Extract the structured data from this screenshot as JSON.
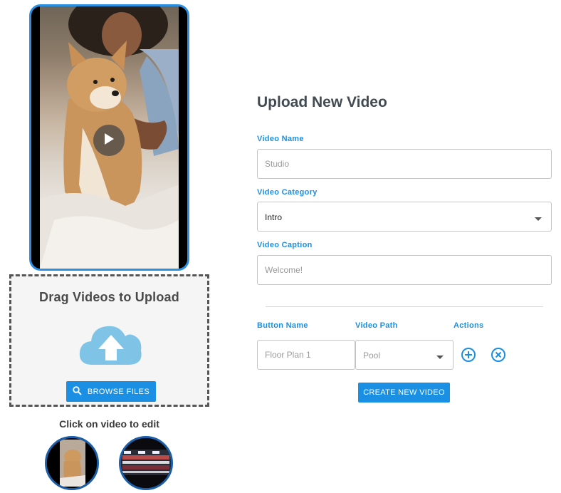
{
  "preview": {
    "play_icon": "play-icon"
  },
  "dropzone": {
    "title": "Drag Videos to Upload",
    "upload_icon": "cloud-upload-icon",
    "browse_label": "BROWSE FILES",
    "browse_icon": "search-icon"
  },
  "thumbnails": {
    "caption": "Click on video to edit",
    "items": [
      "video-thumbnail-1",
      "video-thumbnail-2"
    ]
  },
  "form": {
    "title": "Upload New Video",
    "video_name": {
      "label": "Video Name",
      "placeholder": "Studio"
    },
    "video_category": {
      "label": "Video Category",
      "value": "Intro"
    },
    "video_caption": {
      "label": "Video Caption",
      "placeholder": "Welcome!"
    },
    "buttons_table": {
      "col_button_name": "Button Name",
      "col_video_path": "Video Path",
      "col_actions": "Actions",
      "row": {
        "button_name_placeholder": "Floor Plan 1",
        "video_path_value": "Pool"
      }
    },
    "create_label": "CREATE NEW VIDEO"
  },
  "colors": {
    "accent": "#1a8fe3",
    "thumb_border": "#1c5fa8",
    "heading": "#424a52",
    "cloud": "#7fc4e6"
  }
}
